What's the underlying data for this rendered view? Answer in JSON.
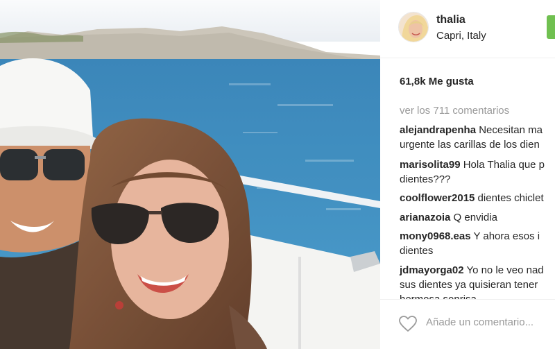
{
  "post": {
    "username": "thalia",
    "location": "Capri, Italy",
    "likes_text": "61,8k Me gusta",
    "view_all_comments": "ver los 711 comentarios",
    "add_comment_placeholder": "Añade un comentario...",
    "follow_button_color": "#70c050"
  },
  "comments": [
    {
      "user": "alejandrapenha",
      "line1": " Necesitan ma",
      "line2": "urgente las carillas de los dien"
    },
    {
      "user": "marisolita99",
      "line1": " Hola Thalia que p",
      "line2": "dientes???"
    },
    {
      "user": "coolflower2015",
      "line1": " dientes chiclet",
      "line2": ""
    },
    {
      "user": "arianazoia",
      "line1": " Q envidia",
      "line2": ""
    },
    {
      "user": "mony0968.eas",
      "line1": " Y ahora esos i",
      "line2": "dientes"
    },
    {
      "user": "jdmayorga02",
      "line1": " Yo no le veo nad",
      "line2": "sus dientes ya quisieran tener",
      "line3": "hermosa sonrisa"
    }
  ],
  "icons": {
    "like": "heart-outline-icon"
  }
}
